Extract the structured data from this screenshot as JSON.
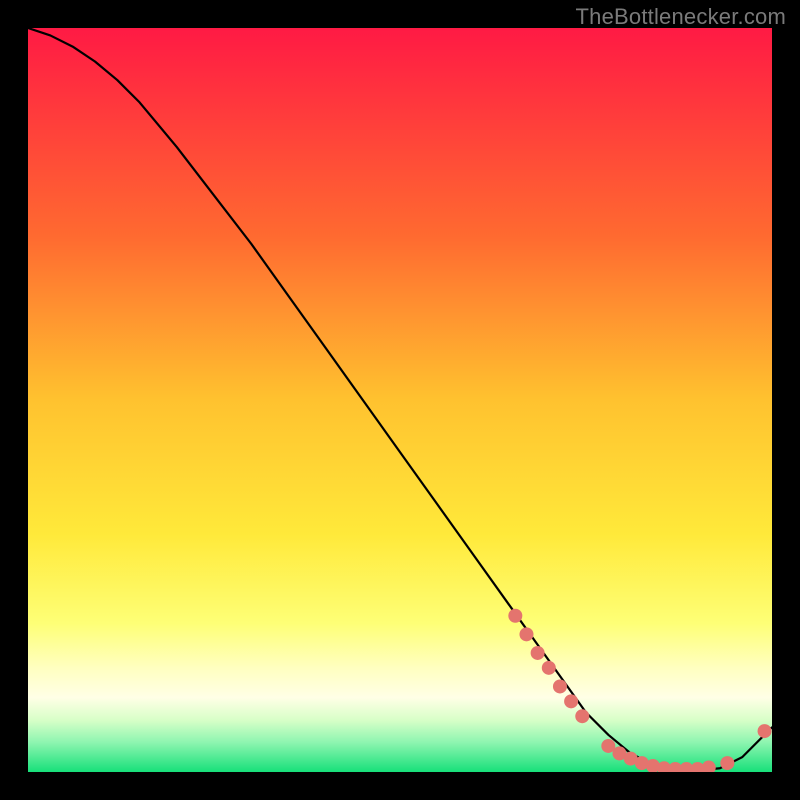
{
  "watermark": "TheBottlenecker.com",
  "chart_data": {
    "type": "line",
    "title": "",
    "xlabel": "",
    "ylabel": "",
    "xlim": [
      0,
      100
    ],
    "ylim": [
      0,
      100
    ],
    "grid": false,
    "background_gradient": {
      "top": "#ff1a44",
      "mid_upper": "#ff9a2a",
      "mid": "#ffe63a",
      "mid_lower": "#f5ff7a",
      "band_pale_yellow": "#ffffcc",
      "band_mint": "#8ef5b0",
      "bottom": "#17e07a"
    },
    "series": [
      {
        "name": "bottleneck-curve",
        "color": "#000000",
        "x": [
          0,
          3,
          6,
          9,
          12,
          15,
          20,
          25,
          30,
          35,
          40,
          45,
          50,
          55,
          60,
          65,
          70,
          75,
          78,
          81,
          84,
          87,
          90,
          93,
          96,
          100
        ],
        "y": [
          100,
          99,
          97.5,
          95.5,
          93,
          90,
          84,
          77.5,
          71,
          64,
          57,
          50,
          43,
          36,
          29,
          22,
          15,
          8,
          5,
          2.5,
          1,
          0.4,
          0.2,
          0.5,
          2,
          6
        ]
      }
    ],
    "markers": [
      {
        "name": "hot-zone-dots",
        "color": "#e4746e",
        "radius": 7,
        "points": [
          {
            "x": 65.5,
            "y": 21
          },
          {
            "x": 67,
            "y": 18.5
          },
          {
            "x": 68.5,
            "y": 16
          },
          {
            "x": 70,
            "y": 14
          },
          {
            "x": 71.5,
            "y": 11.5
          },
          {
            "x": 73,
            "y": 9.5
          },
          {
            "x": 74.5,
            "y": 7.5
          },
          {
            "x": 78,
            "y": 3.5
          },
          {
            "x": 79.5,
            "y": 2.5
          },
          {
            "x": 81,
            "y": 1.8
          },
          {
            "x": 82.5,
            "y": 1.2
          },
          {
            "x": 84,
            "y": 0.8
          },
          {
            "x": 85.5,
            "y": 0.5
          },
          {
            "x": 87,
            "y": 0.4
          },
          {
            "x": 88.5,
            "y": 0.4
          },
          {
            "x": 90,
            "y": 0.4
          },
          {
            "x": 91.5,
            "y": 0.6
          },
          {
            "x": 94,
            "y": 1.2
          },
          {
            "x": 99,
            "y": 5.5
          }
        ]
      }
    ]
  }
}
